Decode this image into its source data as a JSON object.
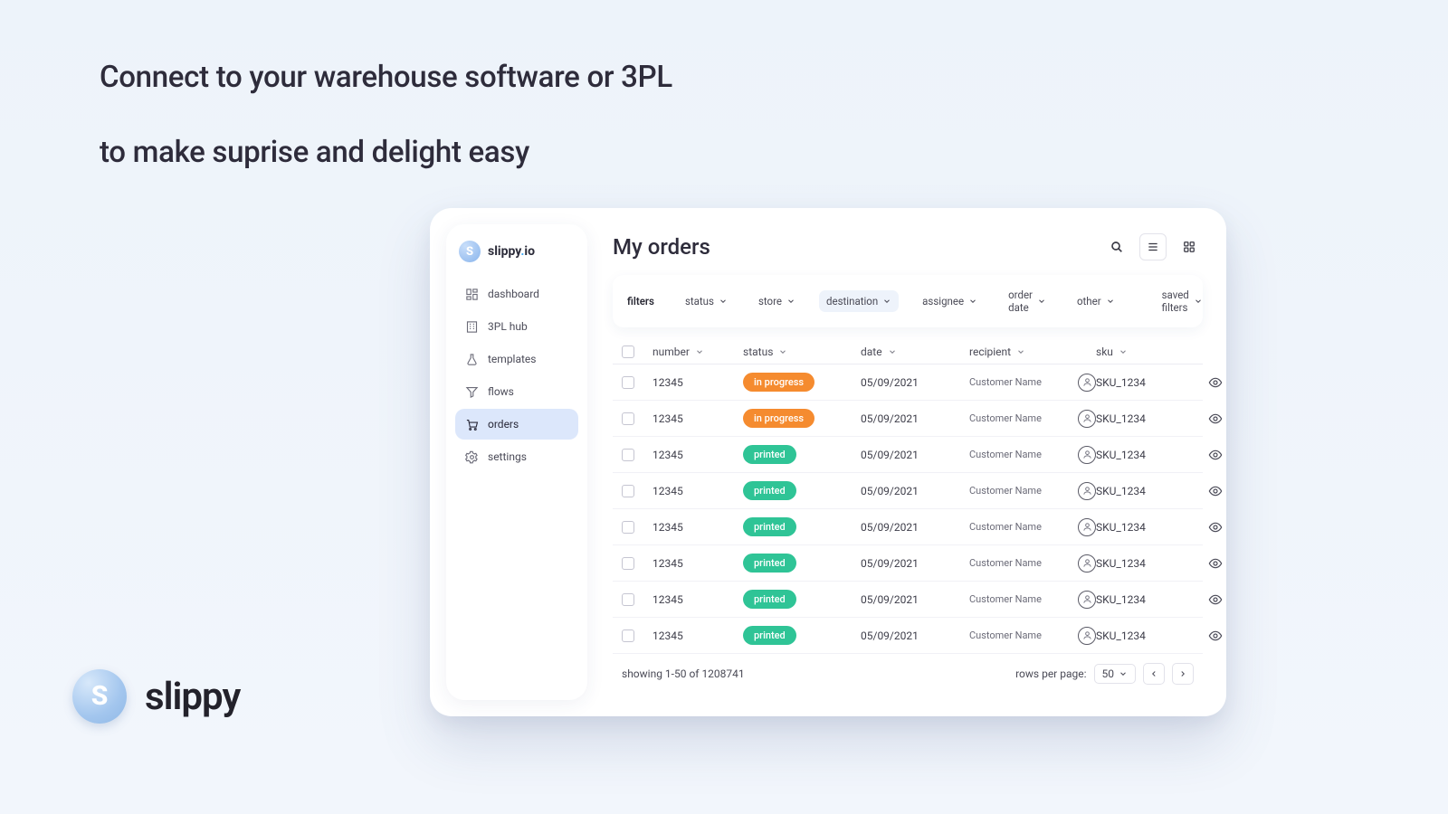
{
  "headline": {
    "line1": "Connect to your warehouse software or 3PL",
    "line2": "to make suprise and delight easy"
  },
  "brand": {
    "name": "slippy"
  },
  "sidebar": {
    "brand_prefix": "slippy",
    "brand_suffix": "io",
    "items": [
      {
        "icon": "dashboard-icon",
        "label": "dashboard",
        "active": false
      },
      {
        "icon": "building-icon",
        "label": "3PL hub",
        "active": false
      },
      {
        "icon": "flask-icon",
        "label": "templates",
        "active": false
      },
      {
        "icon": "funnel-icon",
        "label": "flows",
        "active": false
      },
      {
        "icon": "cart-icon",
        "label": "orders",
        "active": true
      },
      {
        "icon": "gear-icon",
        "label": "settings",
        "active": false
      }
    ]
  },
  "page": {
    "title": "My orders"
  },
  "filters": {
    "label": "filters",
    "items": [
      {
        "label": "status",
        "active": false
      },
      {
        "label": "store",
        "active": false
      },
      {
        "label": "destination",
        "active": true
      },
      {
        "label": "assignee",
        "active": false
      },
      {
        "label": "order date",
        "active": false
      },
      {
        "label": "other",
        "active": false
      }
    ],
    "saved_filters_label": "saved filters"
  },
  "columns": {
    "number": "number",
    "status": "status",
    "date": "date",
    "recipient": "recipient",
    "sku": "sku"
  },
  "rows": [
    {
      "number": "12345",
      "status_label": "in progress",
      "status_color": "orange",
      "date": "05/09/2021",
      "recipient": "Customer Name",
      "sku": "SKU_1234"
    },
    {
      "number": "12345",
      "status_label": "in progress",
      "status_color": "orange",
      "date": "05/09/2021",
      "recipient": "Customer Name",
      "sku": "SKU_1234"
    },
    {
      "number": "12345",
      "status_label": "printed",
      "status_color": "green",
      "date": "05/09/2021",
      "recipient": "Customer Name",
      "sku": "SKU_1234"
    },
    {
      "number": "12345",
      "status_label": "printed",
      "status_color": "green",
      "date": "05/09/2021",
      "recipient": "Customer Name",
      "sku": "SKU_1234"
    },
    {
      "number": "12345",
      "status_label": "printed",
      "status_color": "green",
      "date": "05/09/2021",
      "recipient": "Customer Name",
      "sku": "SKU_1234"
    },
    {
      "number": "12345",
      "status_label": "printed",
      "status_color": "green",
      "date": "05/09/2021",
      "recipient": "Customer Name",
      "sku": "SKU_1234"
    },
    {
      "number": "12345",
      "status_label": "printed",
      "status_color": "green",
      "date": "05/09/2021",
      "recipient": "Customer Name",
      "sku": "SKU_1234"
    },
    {
      "number": "12345",
      "status_label": "printed",
      "status_color": "green",
      "date": "05/09/2021",
      "recipient": "Customer Name",
      "sku": "SKU_1234"
    }
  ],
  "footer": {
    "showing": "showing 1-50 of 1208741",
    "rpp_label": "rows per page:",
    "rpp_value": "50"
  },
  "colors": {
    "orange": "#f58b2f",
    "green": "#2fc496",
    "accent_blue": "#3fa9f5",
    "sidebar_active": "#dce7fb"
  }
}
